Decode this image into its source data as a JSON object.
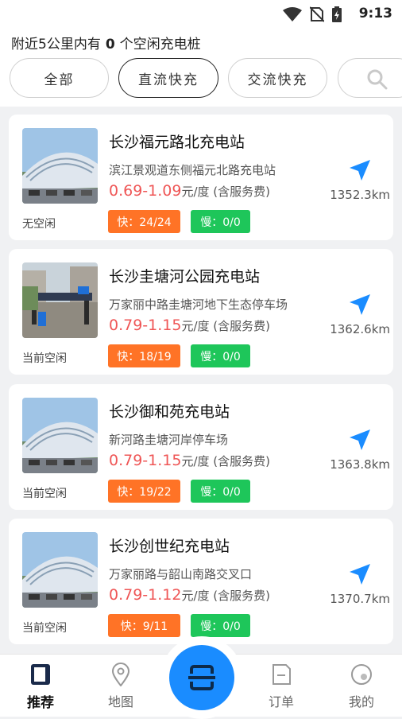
{
  "status_bar": {
    "time": "9:13"
  },
  "summary": {
    "prefix": "附近5公里内有",
    "count": "0",
    "suffix": "个空闲充电桩"
  },
  "filters": [
    "全部",
    "直流快充",
    "交流快充"
  ],
  "unit_suffix": "元/度 (含服务费)",
  "stations": [
    {
      "name": "长沙福元路北充电站",
      "address": "滨江景观道东侧福元北路充电站",
      "price": "0.69-1.09",
      "status": "无空闲",
      "fast": "快：24/24",
      "slow": "慢：0/0",
      "distance": "1352.3km"
    },
    {
      "name": "长沙圭塘河公园充电站",
      "address": "万家丽中路圭塘河地下生态停车场",
      "price": "0.79-1.15",
      "status": "当前空闲",
      "fast": "快：18/19",
      "slow": "慢：0/0",
      "distance": "1362.6km"
    },
    {
      "name": "长沙御和苑充电站",
      "address": "新河路圭塘河岸停车场",
      "price": "0.79-1.15",
      "status": "当前空闲",
      "fast": "快：19/22",
      "slow": "慢：0/0",
      "distance": "1363.8km"
    },
    {
      "name": "长沙创世纪充电站",
      "address": "万家丽路与韶山南路交叉口",
      "price": "0.79-1.12",
      "status": "当前空闲",
      "fast": "快：9/11",
      "slow": "慢：0/0",
      "distance": "1370.7km"
    }
  ],
  "tabs": [
    {
      "label": "推荐",
      "icon": "recommend-icon",
      "active": true
    },
    {
      "label": "地图",
      "icon": "map-pin-icon",
      "active": false
    },
    {
      "label": "订单",
      "icon": "order-icon",
      "active": false
    },
    {
      "label": "我的",
      "icon": "profile-icon",
      "active": false
    }
  ],
  "colors": {
    "accent": "#1a8cff",
    "price": "#ef5656",
    "fast": "#ff7326",
    "slow": "#1ec65a"
  }
}
